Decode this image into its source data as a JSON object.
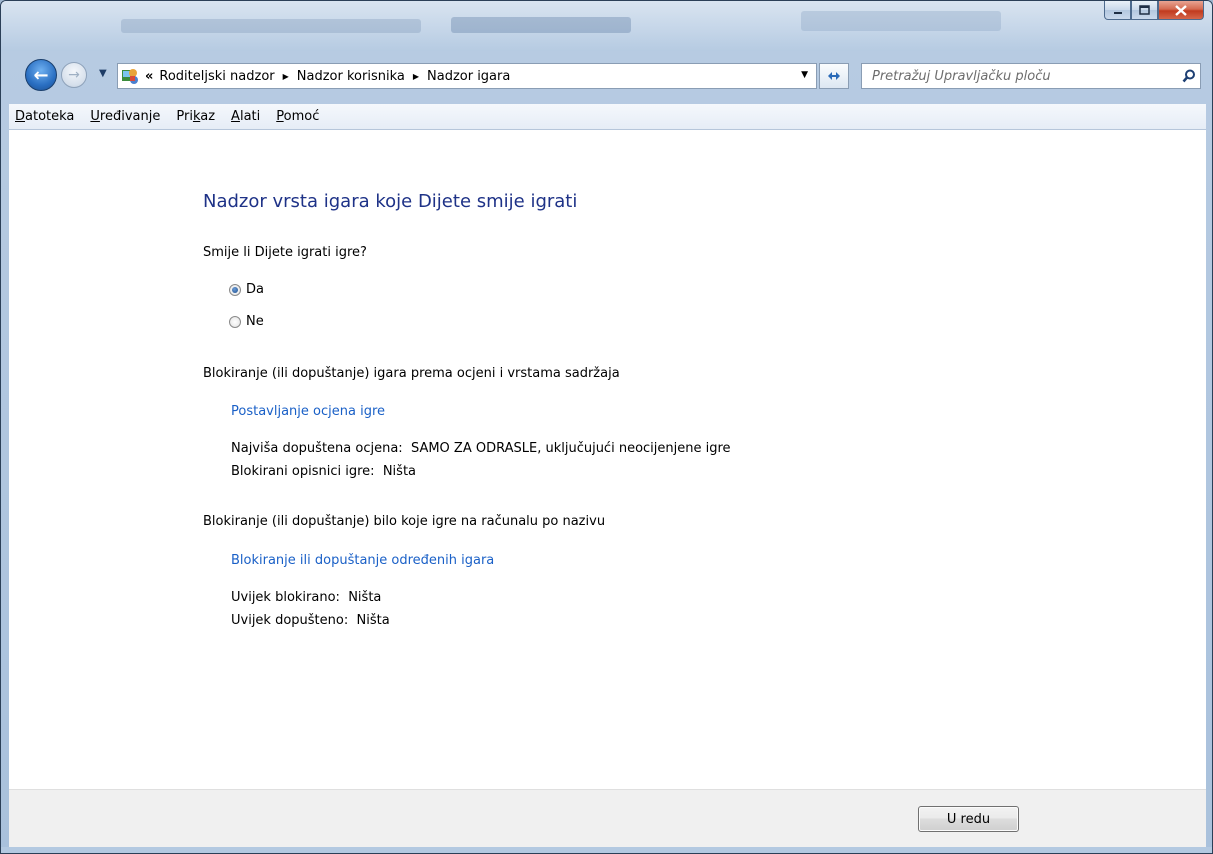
{
  "window": {
    "caption_buttons": {
      "minimize_icon": "minimize-icon",
      "maximize_icon": "maximize-icon",
      "close_icon": "close-icon"
    }
  },
  "navigation": {
    "breadcrumb": {
      "overflow": "«",
      "items": [
        "Roditeljski nadzor",
        "Nadzor korisnika",
        "Nadzor igara"
      ]
    },
    "search": {
      "placeholder": "Pretražuj Upravljačku ploču"
    }
  },
  "menu": {
    "items": [
      {
        "pre": "",
        "key": "D",
        "post": "atoteka"
      },
      {
        "pre": "",
        "key": "U",
        "post": "ređivanje"
      },
      {
        "pre": "Pri",
        "key": "k",
        "post": "az"
      },
      {
        "pre": "",
        "key": "A",
        "post": "lati"
      },
      {
        "pre": "",
        "key": "P",
        "post": "omoć"
      }
    ]
  },
  "content": {
    "heading": "Nadzor vrsta igara koje Dijete smije igrati",
    "question": "Smije li Dijete igrati igre?",
    "options": [
      {
        "label": "Da",
        "checked": true
      },
      {
        "label": "Ne",
        "checked": false
      }
    ],
    "rating_section": {
      "title": "Blokiranje (ili dopuštanje) igara prema ocjeni i vrstama sadržaja",
      "link": "Postavljanje ocjena igre",
      "max_rating_label": "Najviša dopuštena ocjena:",
      "max_rating_value": "SAMO ZA ODRASLE, uključujući neocijenjene igre",
      "blocked_descriptors_label": "Blokirani opisnici igre:",
      "blocked_descriptors_value": "Ništa"
    },
    "name_section": {
      "title": "Blokiranje (ili dopuštanje) bilo koje igre na računalu po nazivu",
      "link": "Blokiranje ili dopuštanje određenih igara",
      "always_blocked_label": "Uvijek blokirano:",
      "always_blocked_value": "Ništa",
      "always_allowed_label": "Uvijek dopušteno:",
      "always_allowed_value": "Ništa"
    }
  },
  "footer": {
    "ok_label": "U redu"
  },
  "colors": {
    "heading": "#1e3287",
    "link": "#1a60c7"
  }
}
